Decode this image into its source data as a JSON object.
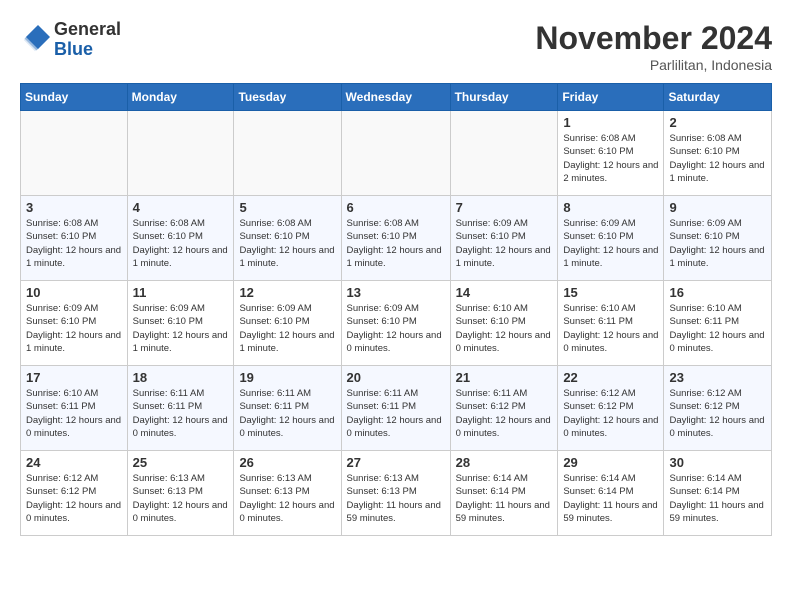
{
  "logo": {
    "general": "General",
    "blue": "Blue"
  },
  "title": "November 2024",
  "location": "Parlilitan, Indonesia",
  "days_of_week": [
    "Sunday",
    "Monday",
    "Tuesday",
    "Wednesday",
    "Thursday",
    "Friday",
    "Saturday"
  ],
  "weeks": [
    [
      {
        "day": "",
        "info": ""
      },
      {
        "day": "",
        "info": ""
      },
      {
        "day": "",
        "info": ""
      },
      {
        "day": "",
        "info": ""
      },
      {
        "day": "",
        "info": ""
      },
      {
        "day": "1",
        "info": "Sunrise: 6:08 AM\nSunset: 6:10 PM\nDaylight: 12 hours and 2 minutes."
      },
      {
        "day": "2",
        "info": "Sunrise: 6:08 AM\nSunset: 6:10 PM\nDaylight: 12 hours and 1 minute."
      }
    ],
    [
      {
        "day": "3",
        "info": "Sunrise: 6:08 AM\nSunset: 6:10 PM\nDaylight: 12 hours and 1 minute."
      },
      {
        "day": "4",
        "info": "Sunrise: 6:08 AM\nSunset: 6:10 PM\nDaylight: 12 hours and 1 minute."
      },
      {
        "day": "5",
        "info": "Sunrise: 6:08 AM\nSunset: 6:10 PM\nDaylight: 12 hours and 1 minute."
      },
      {
        "day": "6",
        "info": "Sunrise: 6:08 AM\nSunset: 6:10 PM\nDaylight: 12 hours and 1 minute."
      },
      {
        "day": "7",
        "info": "Sunrise: 6:09 AM\nSunset: 6:10 PM\nDaylight: 12 hours and 1 minute."
      },
      {
        "day": "8",
        "info": "Sunrise: 6:09 AM\nSunset: 6:10 PM\nDaylight: 12 hours and 1 minute."
      },
      {
        "day": "9",
        "info": "Sunrise: 6:09 AM\nSunset: 6:10 PM\nDaylight: 12 hours and 1 minute."
      }
    ],
    [
      {
        "day": "10",
        "info": "Sunrise: 6:09 AM\nSunset: 6:10 PM\nDaylight: 12 hours and 1 minute."
      },
      {
        "day": "11",
        "info": "Sunrise: 6:09 AM\nSunset: 6:10 PM\nDaylight: 12 hours and 1 minute."
      },
      {
        "day": "12",
        "info": "Sunrise: 6:09 AM\nSunset: 6:10 PM\nDaylight: 12 hours and 1 minute."
      },
      {
        "day": "13",
        "info": "Sunrise: 6:09 AM\nSunset: 6:10 PM\nDaylight: 12 hours and 0 minutes."
      },
      {
        "day": "14",
        "info": "Sunrise: 6:10 AM\nSunset: 6:10 PM\nDaylight: 12 hours and 0 minutes."
      },
      {
        "day": "15",
        "info": "Sunrise: 6:10 AM\nSunset: 6:11 PM\nDaylight: 12 hours and 0 minutes."
      },
      {
        "day": "16",
        "info": "Sunrise: 6:10 AM\nSunset: 6:11 PM\nDaylight: 12 hours and 0 minutes."
      }
    ],
    [
      {
        "day": "17",
        "info": "Sunrise: 6:10 AM\nSunset: 6:11 PM\nDaylight: 12 hours and 0 minutes."
      },
      {
        "day": "18",
        "info": "Sunrise: 6:11 AM\nSunset: 6:11 PM\nDaylight: 12 hours and 0 minutes."
      },
      {
        "day": "19",
        "info": "Sunrise: 6:11 AM\nSunset: 6:11 PM\nDaylight: 12 hours and 0 minutes."
      },
      {
        "day": "20",
        "info": "Sunrise: 6:11 AM\nSunset: 6:11 PM\nDaylight: 12 hours and 0 minutes."
      },
      {
        "day": "21",
        "info": "Sunrise: 6:11 AM\nSunset: 6:12 PM\nDaylight: 12 hours and 0 minutes."
      },
      {
        "day": "22",
        "info": "Sunrise: 6:12 AM\nSunset: 6:12 PM\nDaylight: 12 hours and 0 minutes."
      },
      {
        "day": "23",
        "info": "Sunrise: 6:12 AM\nSunset: 6:12 PM\nDaylight: 12 hours and 0 minutes."
      }
    ],
    [
      {
        "day": "24",
        "info": "Sunrise: 6:12 AM\nSunset: 6:12 PM\nDaylight: 12 hours and 0 minutes."
      },
      {
        "day": "25",
        "info": "Sunrise: 6:13 AM\nSunset: 6:13 PM\nDaylight: 12 hours and 0 minutes."
      },
      {
        "day": "26",
        "info": "Sunrise: 6:13 AM\nSunset: 6:13 PM\nDaylight: 12 hours and 0 minutes."
      },
      {
        "day": "27",
        "info": "Sunrise: 6:13 AM\nSunset: 6:13 PM\nDaylight: 11 hours and 59 minutes."
      },
      {
        "day": "28",
        "info": "Sunrise: 6:14 AM\nSunset: 6:14 PM\nDaylight: 11 hours and 59 minutes."
      },
      {
        "day": "29",
        "info": "Sunrise: 6:14 AM\nSunset: 6:14 PM\nDaylight: 11 hours and 59 minutes."
      },
      {
        "day": "30",
        "info": "Sunrise: 6:14 AM\nSunset: 6:14 PM\nDaylight: 11 hours and 59 minutes."
      }
    ]
  ]
}
